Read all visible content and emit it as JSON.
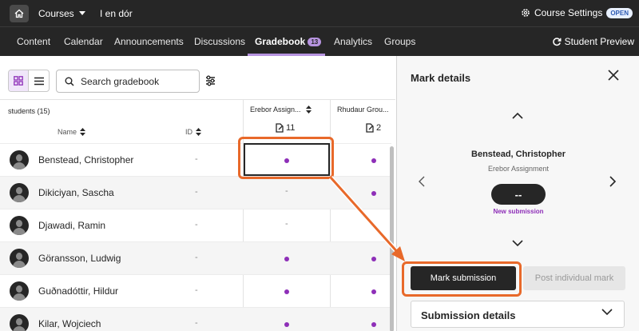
{
  "topbar": {
    "courses_label": "Courses",
    "course_name": "I en dór",
    "settings_label": "Course Settings",
    "open_badge": "OPEN"
  },
  "nav": {
    "tabs": [
      {
        "label": "Content"
      },
      {
        "label": "Calendar"
      },
      {
        "label": "Announcements"
      },
      {
        "label": "Discussions"
      },
      {
        "label": "Gradebook",
        "badge": "13"
      },
      {
        "label": "Analytics"
      },
      {
        "label": "Groups"
      }
    ],
    "student_preview": "Student Preview"
  },
  "toolbar": {
    "search_placeholder": "Search gradebook"
  },
  "grid": {
    "students_label": "students (15)",
    "name_header": "Name",
    "id_header": "ID",
    "columns": [
      {
        "title": "Erebor Assign...",
        "count": "11"
      },
      {
        "title": "Rhudaur Grou...",
        "count": "2"
      }
    ],
    "rows": [
      {
        "name": "Benstead, Christopher",
        "id": "-",
        "col1": "dot",
        "col2": "dot"
      },
      {
        "name": "Dikiciyan, Sascha",
        "id": "-",
        "col1": "-",
        "col2": "dot"
      },
      {
        "name": "Djawadi, Ramin",
        "id": "-",
        "col1": "-",
        "col2": ""
      },
      {
        "name": "Göransson, Ludwig",
        "id": "-",
        "col1": "dot",
        "col2": "dot"
      },
      {
        "name": "Guðnadóttir, Hildur",
        "id": "-",
        "col1": "dot",
        "col2": "dot"
      },
      {
        "name": "Kilar, Wojciech",
        "id": "-",
        "col1": "dot",
        "col2": "dot"
      }
    ]
  },
  "panel": {
    "title": "Mark details",
    "student": "Benstead, Christopher",
    "assignment": "Erebor Assignment",
    "grade": "--",
    "status": "New submission",
    "mark_button": "Mark submission",
    "post_button": "Post individual mark",
    "details_label": "Submission details"
  },
  "colors": {
    "accent": "#8e2fb8",
    "highlight": "#e8692a",
    "dark": "#262626"
  }
}
